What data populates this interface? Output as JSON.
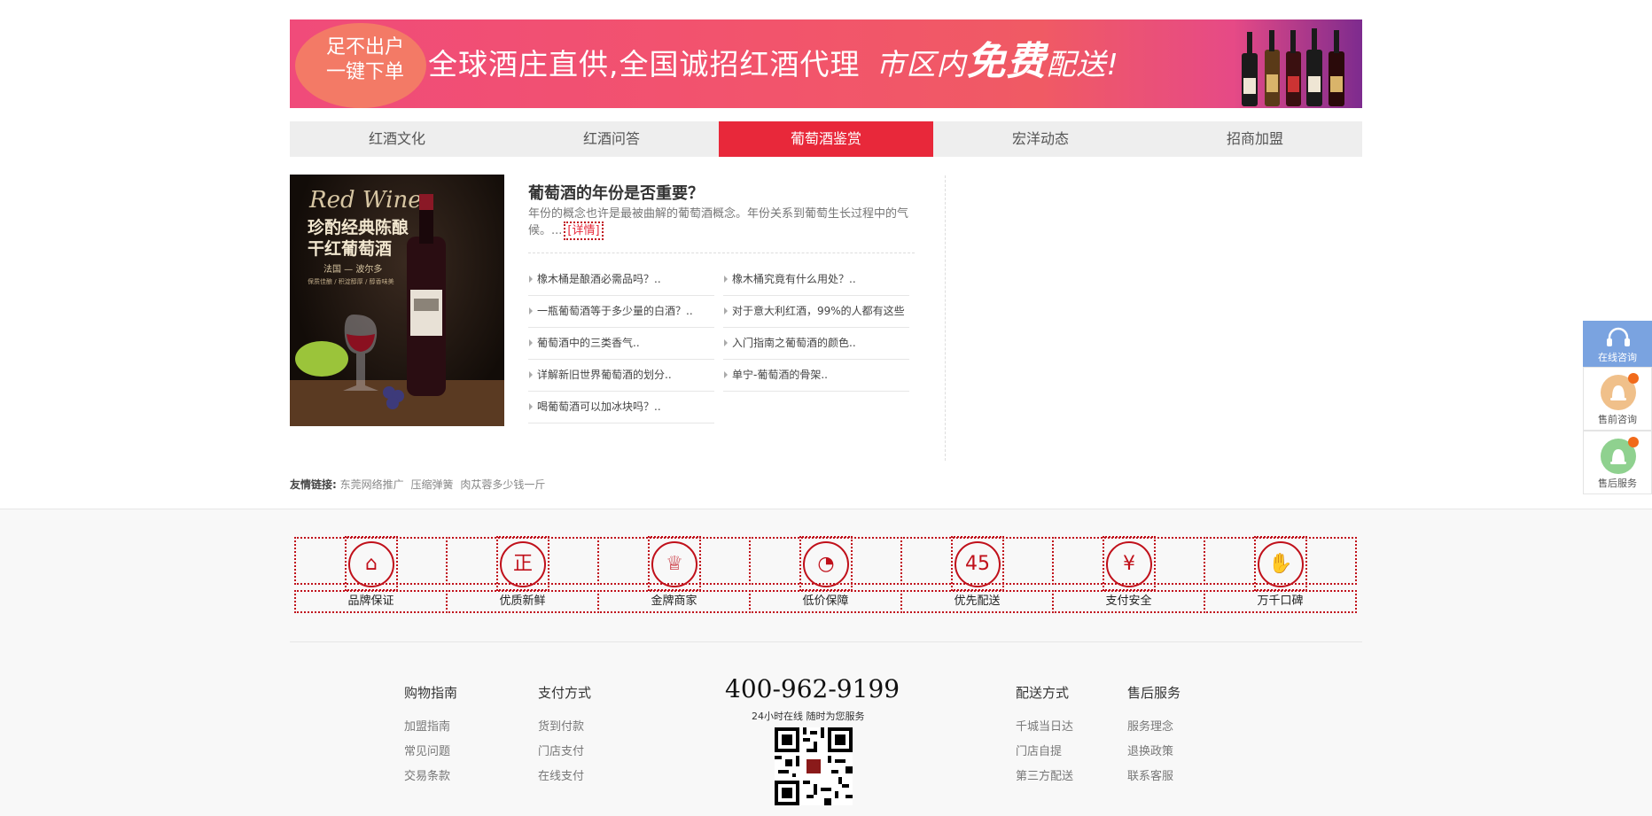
{
  "banner": {
    "bubble_line1": "足不出户",
    "bubble_line2": "一键下单",
    "headline": "全球酒庄直供,全国诚招红酒代理",
    "promo_a": "市区内",
    "promo_b": "免费",
    "promo_c": "配送!"
  },
  "nav": {
    "items": [
      "红酒文化",
      "红酒问答",
      "葡萄酒鉴赏",
      "宏洋动态",
      "招商加盟"
    ],
    "active_index": 2
  },
  "product_image": {
    "script": "Red Wine",
    "title_line1": "珍酌经典陈酿",
    "title_line2": "干红葡萄酒",
    "origin": "法国 — 波尔多",
    "tagline": "保质佳酿 / 积淀醇厚 / 醇香味美"
  },
  "article": {
    "title": "葡萄酒的年份是否重要？",
    "desc": "年份的概念也许是最被曲解的葡萄酒概念。年份关系到葡萄生长过程中的气候。...",
    "more": "[详情]",
    "list": [
      "橡木桶是酿酒必需品吗？..",
      "橡木桶究竟有什么用处？..",
      "一瓶葡萄酒等于多少量的白酒？..",
      "对于意大利红酒，99%的人都有这些",
      "葡萄酒中的三类香气..",
      "入门指南之葡萄酒的颜色..",
      "详解新旧世界葡萄酒的划分..",
      "单宁-葡萄酒的骨架..",
      "喝葡萄酒可以加冰块吗？.."
    ]
  },
  "friends": {
    "label": "友情链接:",
    "links": [
      "东莞网络推广",
      "压缩弹簧",
      "肉苁蓉多少钱一斤"
    ]
  },
  "features": [
    {
      "label": "品牌保证",
      "icon": "shop-icon",
      "glyph": "⌂"
    },
    {
      "label": "优质新鲜",
      "icon": "genuine-icon",
      "glyph": "正"
    },
    {
      "label": "金牌商家",
      "icon": "trophy-icon",
      "glyph": "♕"
    },
    {
      "label": "低价保障",
      "icon": "price-icon",
      "glyph": "◔"
    },
    {
      "label": "优先配送",
      "icon": "delivery-45-icon",
      "glyph": "45"
    },
    {
      "label": "支付安全",
      "icon": "yuan-icon",
      "glyph": "¥"
    },
    {
      "label": "万千口碑",
      "icon": "thumbs-up-icon",
      "glyph": "✋"
    }
  ],
  "footer": {
    "col1": {
      "title": "购物指南",
      "links": [
        "加盟指南",
        "常见问题",
        "交易条款"
      ]
    },
    "col2": {
      "title": "支付方式",
      "links": [
        "货到付款",
        "门店支付",
        "在线支付"
      ]
    },
    "phone": "400-962-9199",
    "phone_sub": "24小时在线 随时为您服务",
    "col3": {
      "title": "配送方式",
      "links": [
        "千城当日达",
        "门店自提",
        "第三方配送"
      ]
    },
    "col4": {
      "title": "售后服务",
      "links": [
        "服务理念",
        "退换政策",
        "联系客服"
      ]
    }
  },
  "side": {
    "online": "在线咨询",
    "presale": "售前咨询",
    "aftersale": "售后服务"
  },
  "colors": {
    "accent": "#e8283a",
    "icon_red": "#c0101a",
    "side_blue": "#7aa3e0"
  }
}
